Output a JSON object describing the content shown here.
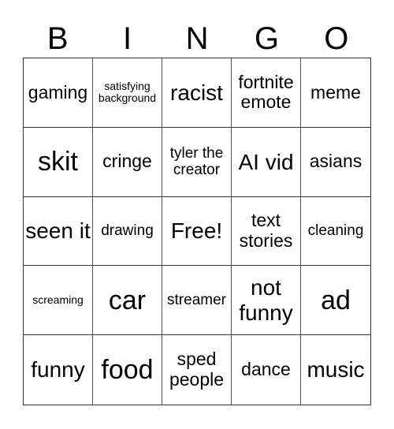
{
  "header": [
    "B",
    "I",
    "N",
    "G",
    "O"
  ],
  "cells": [
    {
      "text": "gaming",
      "size": "m"
    },
    {
      "text": "satisfying background",
      "size": "xs"
    },
    {
      "text": "racist",
      "size": "l"
    },
    {
      "text": "fortnite emote",
      "size": "m"
    },
    {
      "text": "meme",
      "size": "m"
    },
    {
      "text": "skit",
      "size": "xl"
    },
    {
      "text": "cringe",
      "size": "m"
    },
    {
      "text": "tyler the creator",
      "size": "s"
    },
    {
      "text": "AI vid",
      "size": "l"
    },
    {
      "text": "asians",
      "size": "m"
    },
    {
      "text": "seen it",
      "size": "l"
    },
    {
      "text": "drawing",
      "size": "s"
    },
    {
      "text": "Free!",
      "size": "l"
    },
    {
      "text": "text stories",
      "size": "m"
    },
    {
      "text": "cleaning",
      "size": "s"
    },
    {
      "text": "screaming",
      "size": "xs"
    },
    {
      "text": "car",
      "size": "xl"
    },
    {
      "text": "streamer",
      "size": "s"
    },
    {
      "text": "not funny",
      "size": "l"
    },
    {
      "text": "ad",
      "size": "xl"
    },
    {
      "text": "funny",
      "size": "l"
    },
    {
      "text": "food",
      "size": "xl"
    },
    {
      "text": "sped people",
      "size": "m"
    },
    {
      "text": "dance",
      "size": "m"
    },
    {
      "text": "music",
      "size": "l"
    }
  ]
}
